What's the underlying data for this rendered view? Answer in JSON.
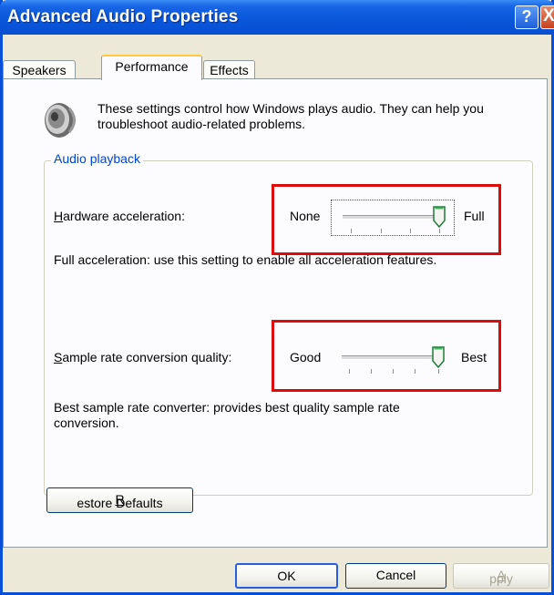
{
  "window": {
    "title": "Advanced Audio Properties"
  },
  "titlebar": {
    "help_glyph": "?",
    "close_glyph": "X"
  },
  "tabs": [
    {
      "label": "Speakers",
      "selected": false
    },
    {
      "label": "Performance",
      "selected": true
    },
    {
      "label": "Effects",
      "selected": false
    }
  ],
  "intro": {
    "text": "These settings control how Windows plays audio. They can help you troubleshoot audio-related problems."
  },
  "group": {
    "label": "Audio playback"
  },
  "hardware_acceleration": {
    "label_prefix": "H",
    "label_rest": "ardware acceleration:",
    "min_label": "None",
    "max_label": "Full",
    "level": 1.0,
    "description": "Full acceleration: use this setting to enable all acceleration features."
  },
  "sample_rate": {
    "label_prefix": "S",
    "label_rest": "ample rate conversion quality:",
    "min_label": "Good",
    "max_label": "Best",
    "level": 1.0,
    "description": "Best sample rate converter:  provides best quality sample rate conversion."
  },
  "buttons": {
    "restore_prefix": "R",
    "restore_rest": "estore Defaults",
    "ok": "OK",
    "cancel": "Cancel",
    "apply_prefix": "A",
    "apply_rest": "pply"
  },
  "colors": {
    "highlight_box": "#dd0b0b",
    "titlebar": "#0a58db",
    "group_label": "#0046d5"
  }
}
